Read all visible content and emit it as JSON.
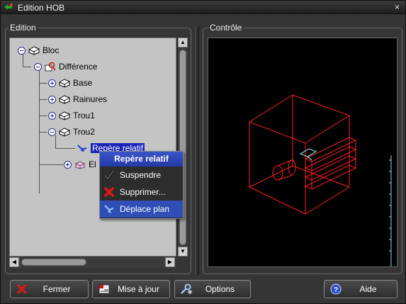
{
  "window": {
    "title": "Edition HOB",
    "close_glyph": "×"
  },
  "panels": {
    "edition_label": "Edition",
    "controle_label": "Contrôle"
  },
  "tree": {
    "nodes": [
      {
        "label": "Bloc",
        "expander": "minus",
        "icon": "solid-block-icon"
      },
      {
        "label": "Différence",
        "expander": "minus",
        "icon": "difference-icon"
      },
      {
        "label": "Base",
        "expander": "plus",
        "icon": "solid-block-icon"
      },
      {
        "label": "Rainures",
        "expander": "plus",
        "icon": "solid-block-icon"
      },
      {
        "label": "Trou1",
        "expander": "plus",
        "icon": "solid-block-icon"
      },
      {
        "label": "Trou2",
        "expander": "minus",
        "icon": "solid-block-icon"
      },
      {
        "label": "Repère relatif",
        "icon": "relative-frame-icon",
        "selected": true
      },
      {
        "label": "El",
        "expander": "plus",
        "icon": "element-icon"
      }
    ]
  },
  "context_menu": {
    "header": "Repère relatif",
    "items": [
      {
        "label": "Suspendre",
        "icon": "checkmark-icon",
        "active": false
      },
      {
        "label": "Supprimer...",
        "icon": "red-x-icon",
        "active": false
      },
      {
        "label": "Déplace plan",
        "icon": "move-plane-icon",
        "active": true
      }
    ]
  },
  "buttons": {
    "fermer": "Fermer",
    "mise_a_jour": "Mise à jour",
    "options": "Options",
    "aide": "Aide"
  },
  "colors": {
    "tree_background": "#c4c4c4",
    "selection": "#1a23b8",
    "menu_highlight": "#2f4fb6",
    "wireframe": "#ff2020",
    "frame_marker": "#7fe0e0"
  }
}
